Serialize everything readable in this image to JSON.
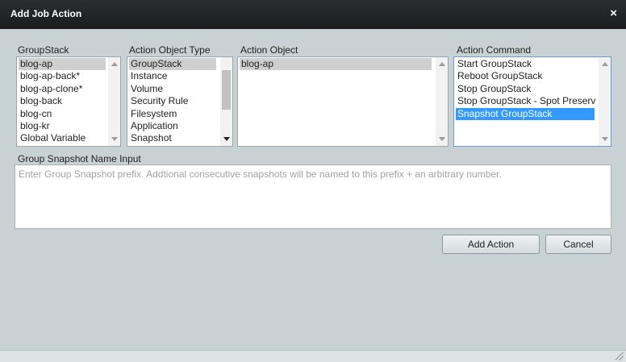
{
  "dialog": {
    "title": "Add Job Action",
    "close_glyph": "×"
  },
  "groupstack": {
    "label": "GroupStack",
    "items": [
      "blog-ap",
      "blog-ap-back*",
      "blog-ap-clone*",
      "blog-back",
      "blog-cn",
      "blog-kr",
      "Global Variable"
    ],
    "selected": "blog-ap"
  },
  "action_object_type": {
    "label": "Action Object Type",
    "items": [
      "GroupStack",
      "Instance",
      "Volume",
      "Security Rule",
      "Filesystem",
      "Application",
      "Snapshot"
    ],
    "selected": "GroupStack"
  },
  "action_object": {
    "label": "Action Object",
    "items": [
      "blog-ap"
    ],
    "selected": "blog-ap"
  },
  "action_command": {
    "label": "Action Command",
    "items": [
      "Start GroupStack",
      "Reboot GroupStack",
      "Stop GroupStack",
      "Stop GroupStack - Spot Preserv",
      "Snapshot GroupStack"
    ],
    "selected": "Snapshot GroupStack"
  },
  "snapshot_input": {
    "label": "Group Snapshot Name Input",
    "placeholder": "Enter Group Snapshot prefix. Addtional consecutive snapshots will be named to this prefix + an arbitrary number."
  },
  "buttons": {
    "add_action": "Add Action",
    "cancel": "Cancel"
  },
  "colors": {
    "titlebar": "#1e1f20",
    "selection_blue": "#3399ff",
    "selection_gray": "#cfcfcf",
    "panel_bg": "#c8d1d4"
  }
}
